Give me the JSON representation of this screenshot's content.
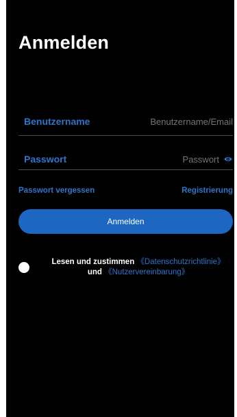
{
  "screen": {
    "title": "Anmelden"
  },
  "username": {
    "label": "Benutzername",
    "placeholder": "Benutzername/Email"
  },
  "password": {
    "label": "Passwort",
    "placeholder": "Passwort",
    "eye_icon": "eye-icon"
  },
  "links": {
    "forgot": "Passwort vergessen",
    "register": "Registrierung"
  },
  "login_button": {
    "label": "Anmelden"
  },
  "agreement": {
    "text_prefix": "Lesen und zustimmen",
    "privacy_link": "《Datenschutzrichtlinie》",
    "connector": "und",
    "terms_link": "《Nutzervereinbarung》",
    "checked": false
  },
  "colors": {
    "background": "#000000",
    "accent": "#2f74c9",
    "button": "#1d66c2",
    "divider": "#4d4d4d"
  }
}
